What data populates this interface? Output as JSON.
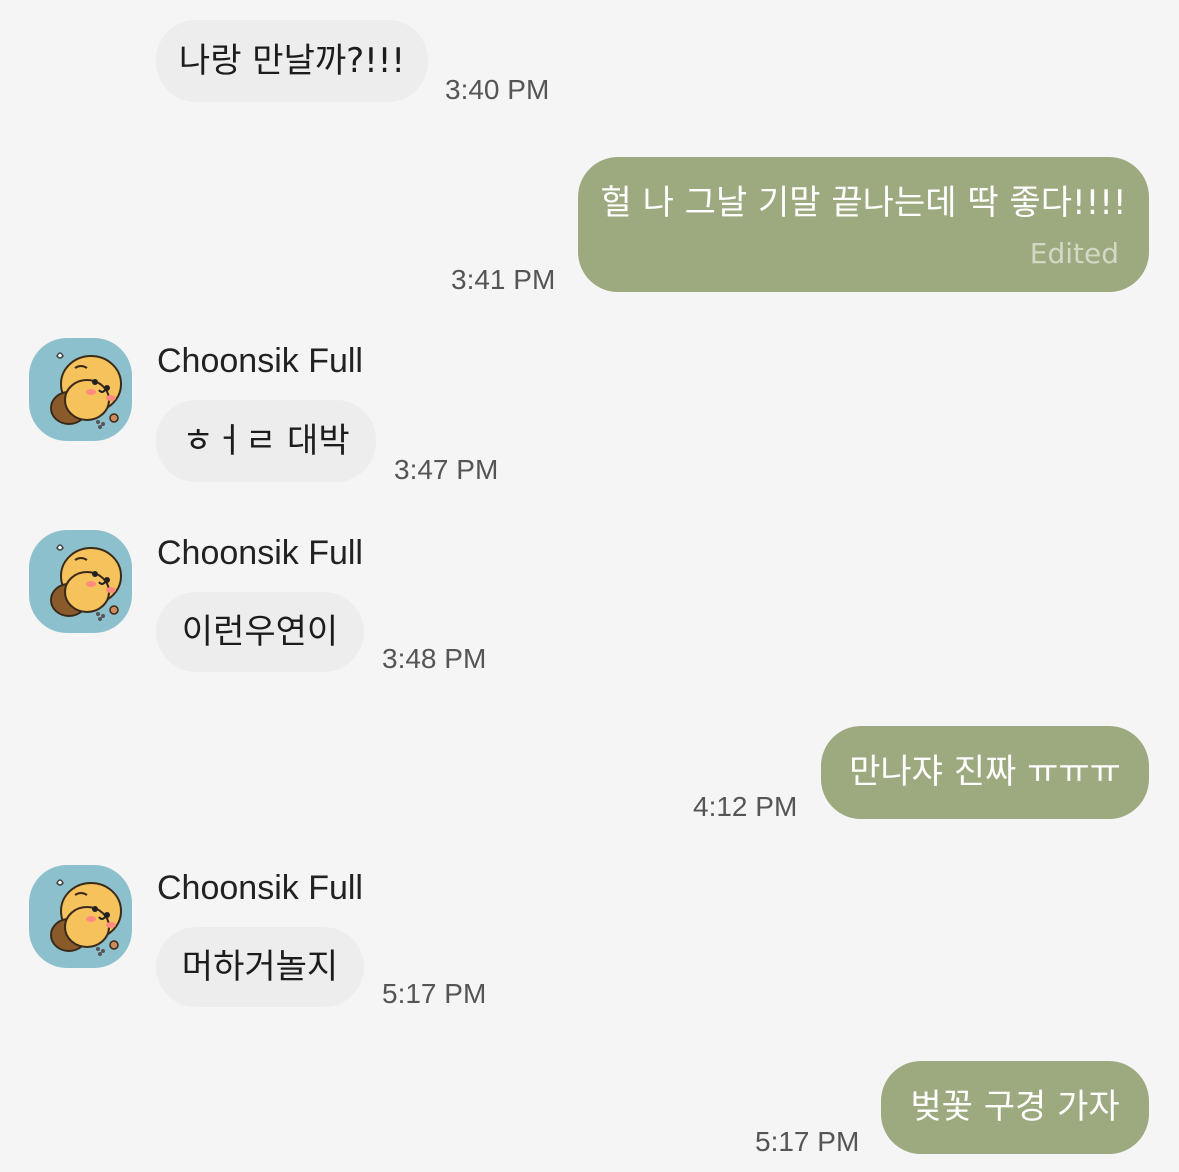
{
  "colors": {
    "background": "#f5f5f5",
    "incoming_bubble": "#ededed",
    "outgoing_bubble": "#9da97f",
    "avatar_bg": "#8cc0cc"
  },
  "avatar_icon": "choonsik-character-icon",
  "messages": [
    {
      "direction": "incoming",
      "text": "나랑 만날까?!!!",
      "time": "3:40 PM"
    },
    {
      "direction": "outgoing",
      "text": "헐 나 그날 기말 끝나는데 딱 좋다!!!!",
      "edited": "Edited",
      "time": "3:41 PM"
    },
    {
      "direction": "incoming",
      "sender": "Choonsik Full",
      "text": "ㅎㅓㄹ 대박",
      "time": "3:47 PM"
    },
    {
      "direction": "incoming",
      "sender": "Choonsik Full",
      "text": "이런우연이",
      "time": "3:48 PM"
    },
    {
      "direction": "outgoing",
      "text": "만나쟈 진짜 ㅠㅠㅠ",
      "time": "4:12 PM"
    },
    {
      "direction": "incoming",
      "sender": "Choonsik Full",
      "text": "머하거놀지",
      "time": "5:17 PM"
    },
    {
      "direction": "outgoing",
      "text": "벚꽃 구경 가자",
      "time": "5:17 PM"
    }
  ]
}
